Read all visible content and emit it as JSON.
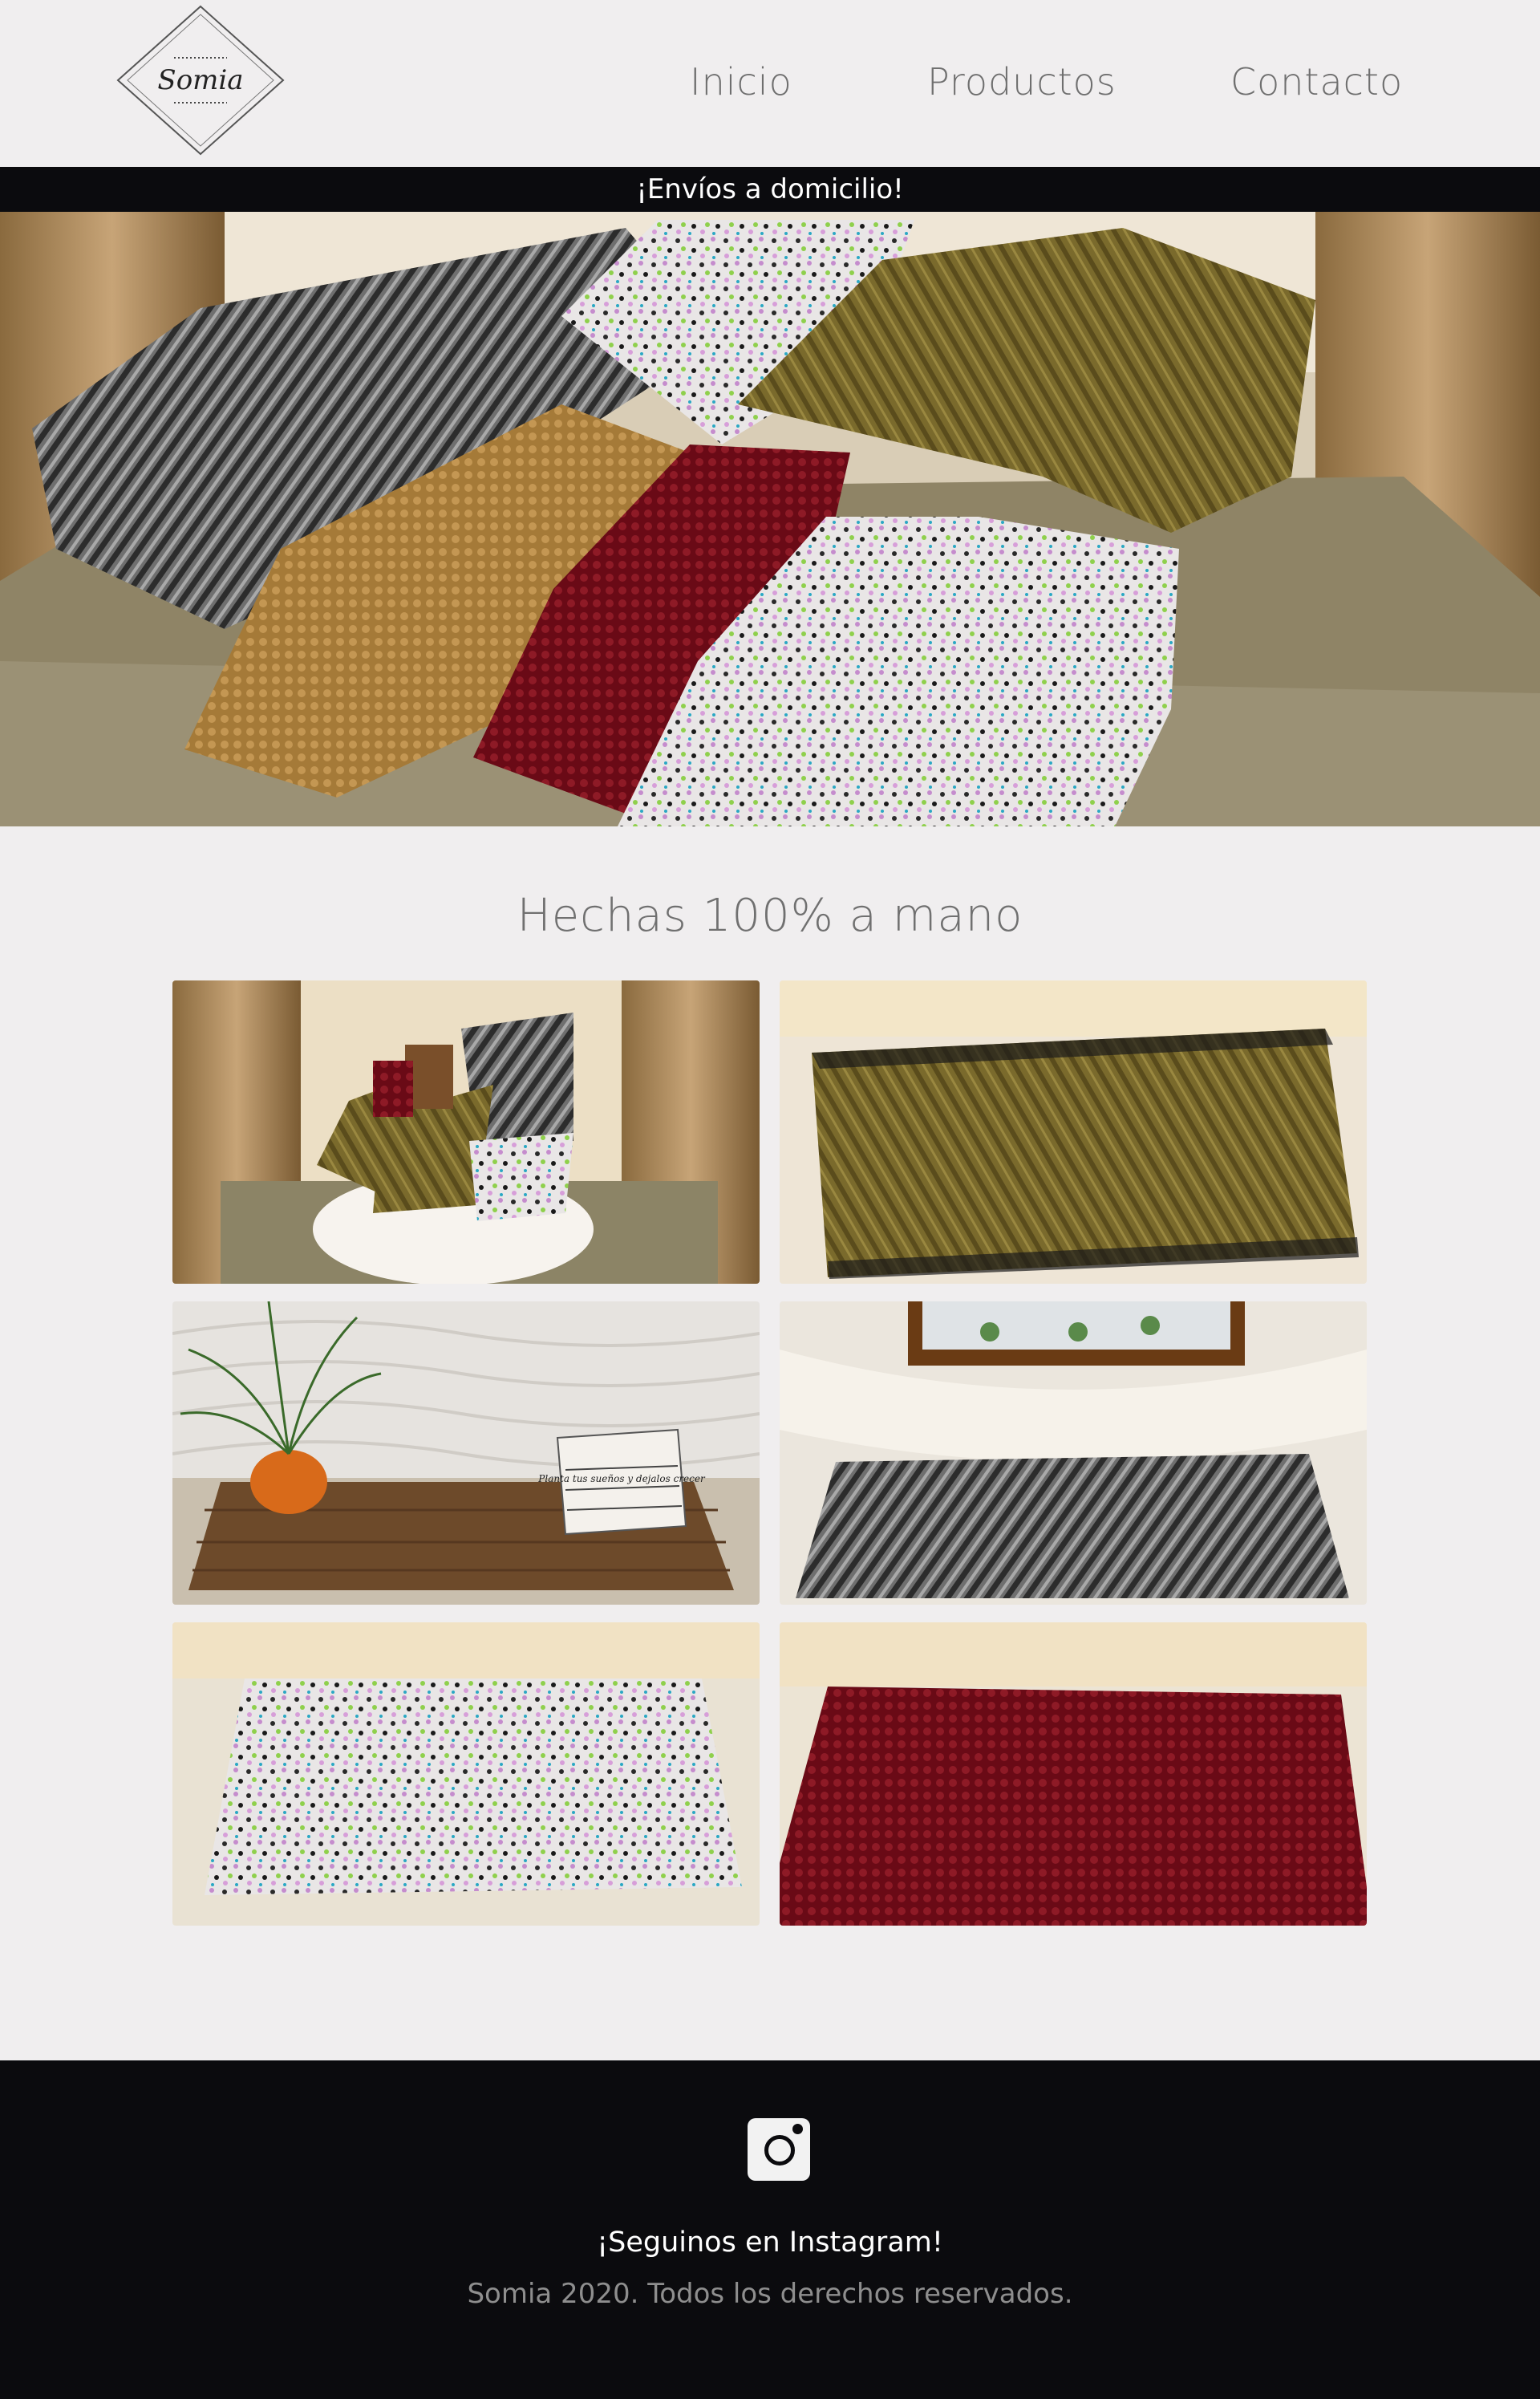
{
  "brand": {
    "logo_text": "Somia"
  },
  "nav": {
    "items": [
      {
        "label": "Inicio"
      },
      {
        "label": "Productos"
      },
      {
        "label": "Contacto"
      }
    ]
  },
  "announcement": {
    "text": "¡Envíos a domicilio!"
  },
  "hero": {
    "image": "hero-rugs-photo"
  },
  "gallery": {
    "title": "Hechas 100% a mano",
    "images": [
      "rug-collection-photo",
      "brown-shag-rug-photo",
      "brown-crochet-rug-photo",
      "gray-shag-rug-photo",
      "multicolor-rug-photo",
      "red-crochet-rug-photo"
    ]
  },
  "crate_sign": {
    "text": "Planta tus sueños y dejalos crecer"
  },
  "footer": {
    "icon": "instagram-icon",
    "follow_text": "¡Seguinos en Instagram!",
    "copyright": "Somia 2020. Todos los derechos reservados."
  },
  "colors": {
    "page_bg": "#f0eeef",
    "bar_bg": "#0b0b0e",
    "nav_text": "#6f6f6f",
    "footer_muted": "#8e8e8e"
  }
}
